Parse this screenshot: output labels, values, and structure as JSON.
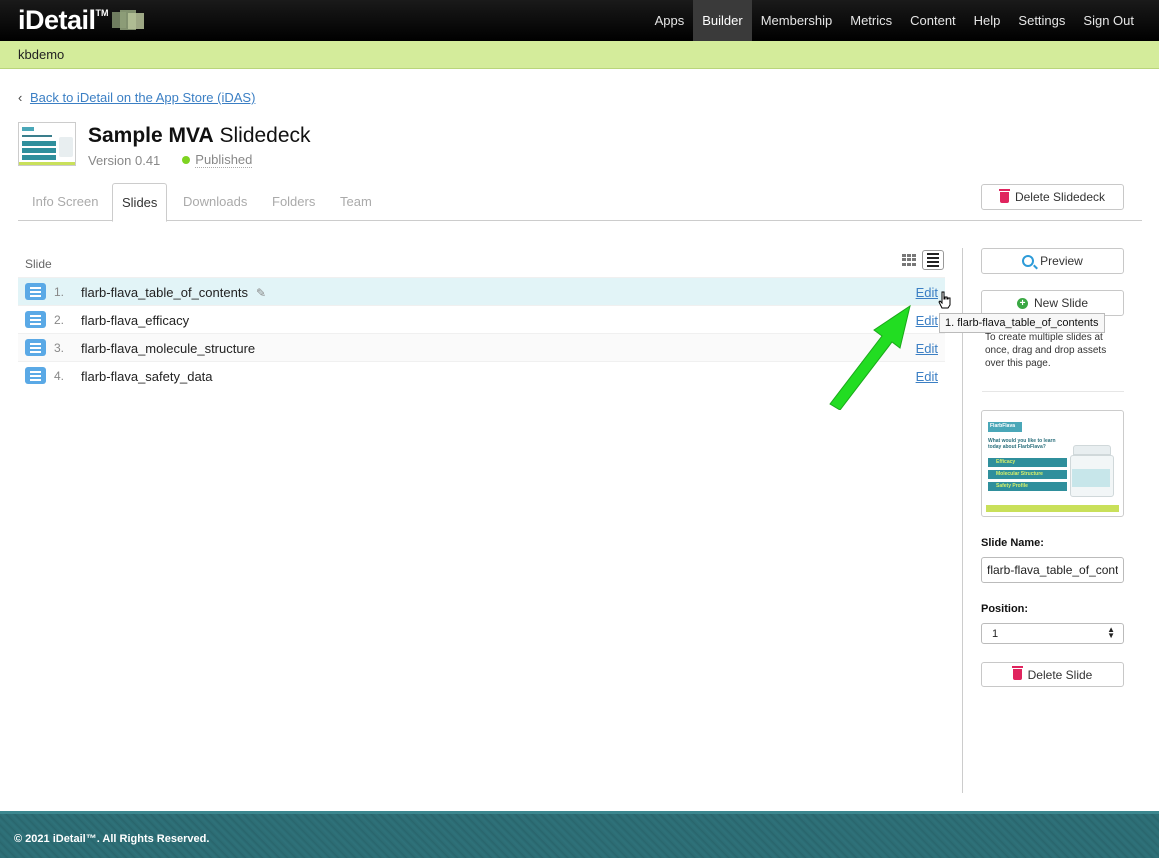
{
  "brand": {
    "name": "iDetail",
    "tm": "TM"
  },
  "nav": [
    {
      "label": "Apps",
      "active": false
    },
    {
      "label": "Builder",
      "active": true
    },
    {
      "label": "Membership",
      "active": false
    },
    {
      "label": "Metrics",
      "active": false
    },
    {
      "label": "Content",
      "active": false
    },
    {
      "label": "Help",
      "active": false
    },
    {
      "label": "Settings",
      "active": false
    },
    {
      "label": "Sign Out",
      "active": false
    }
  ],
  "account": "kbdemo",
  "back_link": "Back to iDetail on the App Store (iDAS)",
  "deck": {
    "title_bold": "Sample MVA",
    "title_rest": " Slidedeck",
    "version": "Version 0.41",
    "status": "Published",
    "status_color": "#7ed321"
  },
  "tabs": [
    {
      "label": "Info Screen",
      "active": false
    },
    {
      "label": "Slides",
      "active": true
    },
    {
      "label": "Downloads",
      "active": false
    },
    {
      "label": "Folders",
      "active": false
    },
    {
      "label": "Team",
      "active": false
    }
  ],
  "delete_deck_label": "Delete Slidedeck",
  "list": {
    "header": "Slide",
    "edit_label": "Edit",
    "rows": [
      {
        "num": "1.",
        "name": "flarb-flava_table_of_contents",
        "selected": true
      },
      {
        "num": "2.",
        "name": "flarb-flava_efficacy",
        "selected": false
      },
      {
        "num": "3.",
        "name": "flarb-flava_molecule_structure",
        "selected": false
      },
      {
        "num": "4.",
        "name": "flarb-flava_safety_data",
        "selected": false
      }
    ]
  },
  "sidebar": {
    "preview_label": "Preview",
    "new_slide_label": "New Slide",
    "tooltip": "1. flarb-flava_table_of_contents",
    "hint": "To create multiple slides at once, drag and drop assets over this page.",
    "thumb": {
      "brand": "FlarbFlava",
      "question": "What would you like to learn today about FlarbFlava?",
      "items": [
        "Efficacy",
        "Molecular Structure",
        "Safety Profile"
      ]
    },
    "slide_name_label": "Slide Name:",
    "slide_name_value": "flarb-flava_table_of_contents",
    "position_label": "Position:",
    "position_value": "1",
    "delete_slide_label": "Delete Slide"
  },
  "footer": "© 2021 iDetail™. All Rights Reserved.",
  "colors": {
    "accent": "#3b7fc4",
    "subbar": "#d4ec9b",
    "footer": "#2c6b72",
    "arrow": "#22dd22",
    "delete": "#e0245e"
  }
}
